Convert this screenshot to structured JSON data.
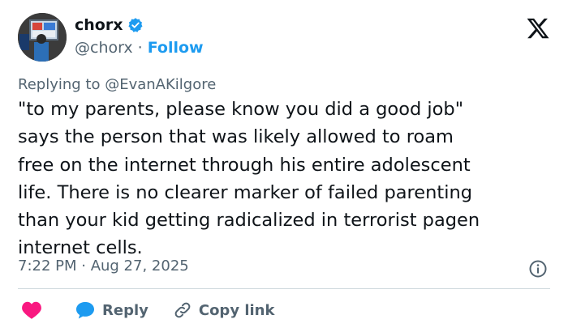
{
  "author": {
    "display_name": "chorx",
    "handle": "@chorx",
    "separator": "·",
    "follow_label": "Follow"
  },
  "replying_to": "Replying to @EvanAKilgore",
  "tweet": {
    "text": "\"to my parents, please know you did a good job\"\nsays the person that was likely allowed to roam\nfree on the internet through his entire adolescent\nlife. There is no clearer marker of failed parenting\nthan your kid getting radicalized in terrorist pagen\ninternet cells."
  },
  "timestamp": "7:22 PM · Aug 27, 2025",
  "actions": {
    "reply_label": "Reply",
    "copy_link_label": "Copy link"
  },
  "icons": {
    "verified": "verified-badge-icon",
    "brand": "x-logo-icon",
    "info": "info-icon",
    "like": "heart-icon",
    "reply": "speech-bubble-icon",
    "link": "link-icon"
  },
  "colors": {
    "accent": "#1d9bf0",
    "like": "#f91880",
    "muted": "#536471",
    "text": "#0f1419"
  }
}
